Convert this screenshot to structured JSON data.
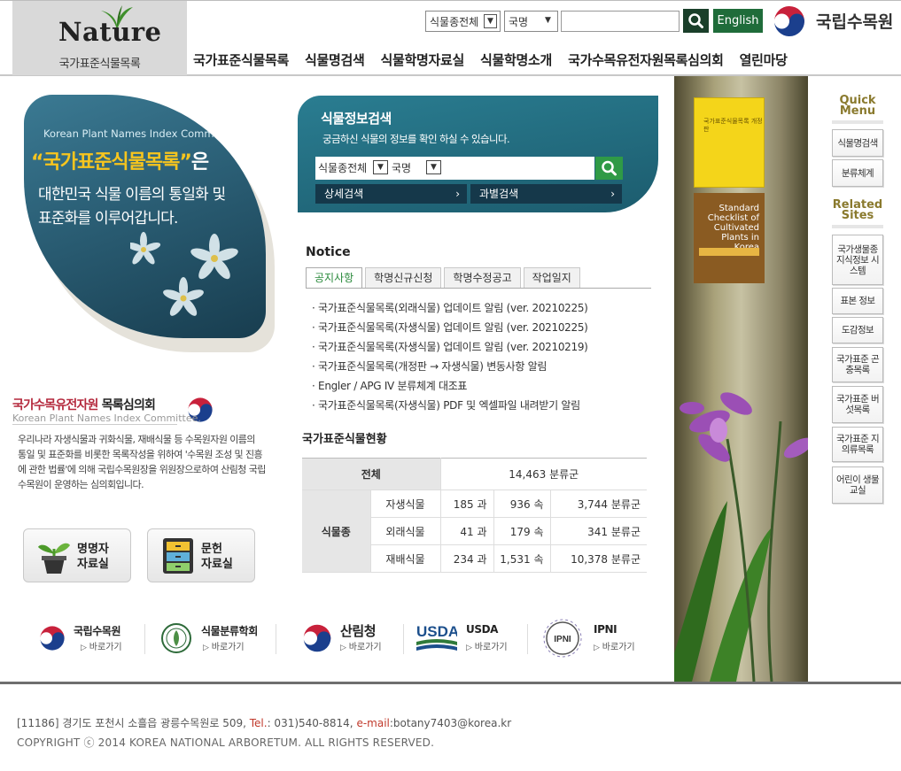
{
  "header": {
    "logo_word": "Nature",
    "logo_sub": "국가표준식물목록",
    "search_scope": "식물종전체",
    "search_field": "국명",
    "search_value": "",
    "english_label": "English",
    "org_name": "국립수목원"
  },
  "nav": {
    "items": [
      "국가표준식물목록",
      "식물명검색",
      "식물학명자료실",
      "식물학명소개",
      "국가수목유전자원목록심의회",
      "열린마당"
    ]
  },
  "hero": {
    "eng": "Korean Plant Names Index Committee",
    "title_highlight": "“국가표준식물목록”",
    "title_suffix": "은",
    "line1": "대한민국 식물 이름의 통일화 및",
    "line2": "표준화를 이루어갑니다."
  },
  "committee": {
    "title_red": "국가수목유전자원",
    "title_rest": " 목록심의회",
    "eng": "Korean Plant Names Index Committee.",
    "desc": "우리나라 자생식물과 귀화식물, 재배식물 등 수목원자원 이름의 통일 및 표준화를 비롯한 목록작성을 위하여 '수목원 조성 및 진흥에 관한 법률'에 의해 국립수목원장을 위원장으로하여 산림청 국립수목원이 운영하는 심의회입니다."
  },
  "big_buttons": [
    {
      "line1": "명명자",
      "line2": "자료실"
    },
    {
      "line1": "문헌",
      "line2": "자료실"
    }
  ],
  "plant_search": {
    "title": "식물정보검색",
    "desc": "궁금하신 식물의 정보를 확인 하실 수 있습니다.",
    "scope": "식물종전체",
    "field": "국명",
    "value": "",
    "tab_detail": "상세검색",
    "tab_family": "과별검색"
  },
  "notice": {
    "heading": "Notice",
    "tabs": [
      "공지사항",
      "학명신규신청",
      "학명수정공고",
      "작업일지"
    ],
    "active_tab": "공지사항",
    "items": [
      "국가표준식물목록(외래식물) 업데이트 알림 (ver. 20210225)",
      "국가표준식물목록(자생식물) 업데이트 알림 (ver. 20210225)",
      "국가표준식물목록(자생식물) 업데이트 알림 (ver. 20210219)",
      "국가표준식물목록(개정판 → 자생식물) 변동사항 알림",
      "Engler / APG IV 분류체계 대조표",
      "국가표준식물목록(자생식물) PDF 및 엑셀파일 내려받기 알림"
    ]
  },
  "status": {
    "title": "국가표준식물현황",
    "total_label": "전체",
    "total_value": "14,463 분류군",
    "group_label": "식물종",
    "rows": [
      {
        "name": "자생식물",
        "family": "185 과",
        "genus": "936 속",
        "taxa": "3,744 분류군"
      },
      {
        "name": "외래식물",
        "family": "41 과",
        "genus": "179 속",
        "taxa": "341 분류군"
      },
      {
        "name": "재배식물",
        "family": "234 과",
        "genus": "1,531 속",
        "taxa": "10,378 분류군"
      }
    ]
  },
  "books": {
    "book1": "국가표준식물목록 개정판",
    "book2": "Standard Checklist of Cultivated Plants in Korea"
  },
  "quick_menu": {
    "title1": "Quick",
    "title2": "Menu",
    "items1": [
      "식물명검색",
      "분류체계"
    ],
    "related1": "Related",
    "related2": "Sites",
    "items2": [
      "국가생물종 지식정보 시스템",
      "표본 정보",
      "도감정보",
      "국가표준 곤충목록",
      "국가표준 버섯목록",
      "국가표준 지의류목록",
      "어린이 생물교실"
    ]
  },
  "partners": [
    {
      "name": "국립수목원",
      "link": "바로가기"
    },
    {
      "name": "식물분류학회",
      "link": "바로가기"
    },
    {
      "name": "산림청",
      "link": "바로가기"
    },
    {
      "name": "USDA",
      "link": "바로가기"
    },
    {
      "name": "IPNI",
      "link": "바로가기"
    }
  ],
  "footer": {
    "address": "[11186] 경기도 포천시 소흘읍 광릉수목원로 509, ",
    "tel_label": "Tel.",
    "tel": ": 031)540-8814, ",
    "email_label": "e-mail",
    "email": ":botany7403@korea.kr",
    "copyright": "COPYRIGHT ⓒ 2014 KOREA NATIONAL ARBORETUM. ALL RIGHTS RESERVED."
  },
  "colors": {
    "brand_green": "#1f6c3a",
    "search_teal": "#2a7d91",
    "accent_red": "#b4283c",
    "tab_active": "#2a8a3c"
  }
}
